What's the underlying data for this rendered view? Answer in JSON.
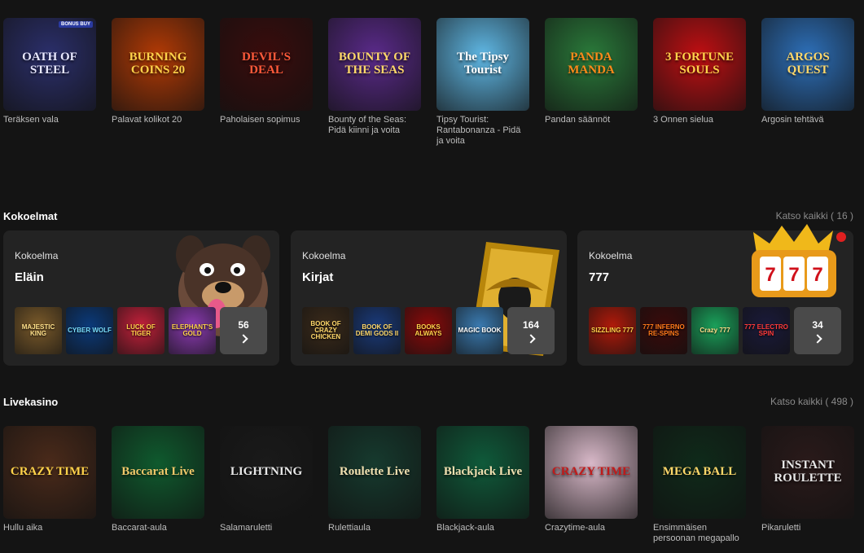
{
  "top_games": [
    {
      "name": "Teräksen vala",
      "art": "OATH OF STEEL",
      "bg": "#2b2f6b",
      "fg": "#e8e8ff",
      "badge": "BONUS BUY"
    },
    {
      "name": "Palavat kolikot 20",
      "art": "BURNING COINS 20",
      "bg": "#b23a05",
      "fg": "#ffd24a"
    },
    {
      "name": "Paholaisen sopimus",
      "art": "DEVIL'S DEAL",
      "bg": "#3a0c0c",
      "fg": "#ff5a3a"
    },
    {
      "name": "Bounty of the Seas: Pidä kiinni ja voita",
      "art": "BOUNTY OF THE SEAS",
      "bg": "#5a2a8a",
      "fg": "#ffd86a"
    },
    {
      "name": "Tipsy Tourist: Rantabonanza - Pidä ja voita",
      "art": "The Tipsy Tourist",
      "bg": "#5fb7e4",
      "fg": "#ffffff"
    },
    {
      "name": "Pandan säännöt",
      "art": "PANDA MANDA",
      "bg": "#2a7a3a",
      "fg": "#ff8a1a"
    },
    {
      "name": "3 Onnen sielua",
      "art": "3 FORTUNE SOULS",
      "bg": "#c00f12",
      "fg": "#ffd24a"
    },
    {
      "name": "Argosin tehtävä",
      "art": "ARGOS QUEST",
      "bg": "#2d6fb8",
      "fg": "#ffd86a"
    }
  ],
  "collections": {
    "title": "Kokoelmat",
    "see_all": "Katso kaikki ( 16 )",
    "cards": [
      {
        "kicker": "Kokoelma",
        "title": "Eläin",
        "count": "56",
        "minis": [
          {
            "label": "MAJESTIC KING",
            "bg": "#7a5a2a",
            "fg": "#ffe08a"
          },
          {
            "label": "CYBER WOLF",
            "bg": "#0b3a7a",
            "fg": "#7adfff"
          },
          {
            "label": "LUCK OF TIGER",
            "bg": "#c2203a",
            "fg": "#ffd24a"
          },
          {
            "label": "ELEPHANT'S GOLD",
            "bg": "#8a3ab0",
            "fg": "#ffd24a"
          }
        ]
      },
      {
        "kicker": "Kokoelma",
        "title": "Kirjat",
        "count": "164",
        "minis": [
          {
            "label": "BOOK OF CRAZY CHICKEN",
            "bg": "#3a2a1a",
            "fg": "#ffd86a"
          },
          {
            "label": "BOOK OF DEMI GODS II",
            "bg": "#1a3a7a",
            "fg": "#ffd86a"
          },
          {
            "label": "BOOKS ALWAYS",
            "bg": "#8a0a0a",
            "fg": "#ffd24a"
          },
          {
            "label": "MAGIC BOOK",
            "bg": "#3a7ab0",
            "fg": "#ffffff"
          }
        ]
      },
      {
        "kicker": "Kokoelma",
        "title": "777",
        "count": "34",
        "minis": [
          {
            "label": "SIZZLING 777",
            "bg": "#b01a0a",
            "fg": "#ffd24a"
          },
          {
            "label": "777 INFERNO RE-SPINS",
            "bg": "#3a0a0a",
            "fg": "#ff7a1a"
          },
          {
            "label": "Crazy 777",
            "bg": "#1aa05a",
            "fg": "#ffe08a"
          },
          {
            "label": "777 ELECTRO SPIN",
            "bg": "#1a1a3a",
            "fg": "#ff3a3a"
          }
        ]
      }
    ]
  },
  "live": {
    "title": "Livekasino",
    "see_all": "Katso kaikki ( 498 )",
    "games": [
      {
        "name": "Hullu aika",
        "art": "CRAZY TIME",
        "bg": "#4a2a1a",
        "fg": "#ffd24a"
      },
      {
        "name": "Baccarat-aula",
        "art": "Baccarat Live",
        "bg": "#0f5a2e",
        "fg": "#f0c86a"
      },
      {
        "name": "Salamaruletti",
        "art": "LIGHTNING",
        "bg": "#1a1a1a",
        "fg": "#e8e8e8"
      },
      {
        "name": "Rulettiaula",
        "art": "Roulette Live",
        "bg": "#163a2e",
        "fg": "#f0e0b0"
      },
      {
        "name": "Blackjack-aula",
        "art": "Blackjack Live",
        "bg": "#0f5a3a",
        "fg": "#f0e0b0"
      },
      {
        "name": "Crazytime-aula",
        "art": "CRAZY TIME",
        "bg": "#d8b8c8",
        "fg": "#c01a1a"
      },
      {
        "name": "Ensimmäisen persoonan megapallo",
        "art": "MEGA BALL",
        "bg": "#0f2a1a",
        "fg": "#ffd86a"
      },
      {
        "name": "Pikaruletti",
        "art": "INSTANT ROULETTE",
        "bg": "#2a1a1a",
        "fg": "#e8e8e8"
      }
    ]
  }
}
